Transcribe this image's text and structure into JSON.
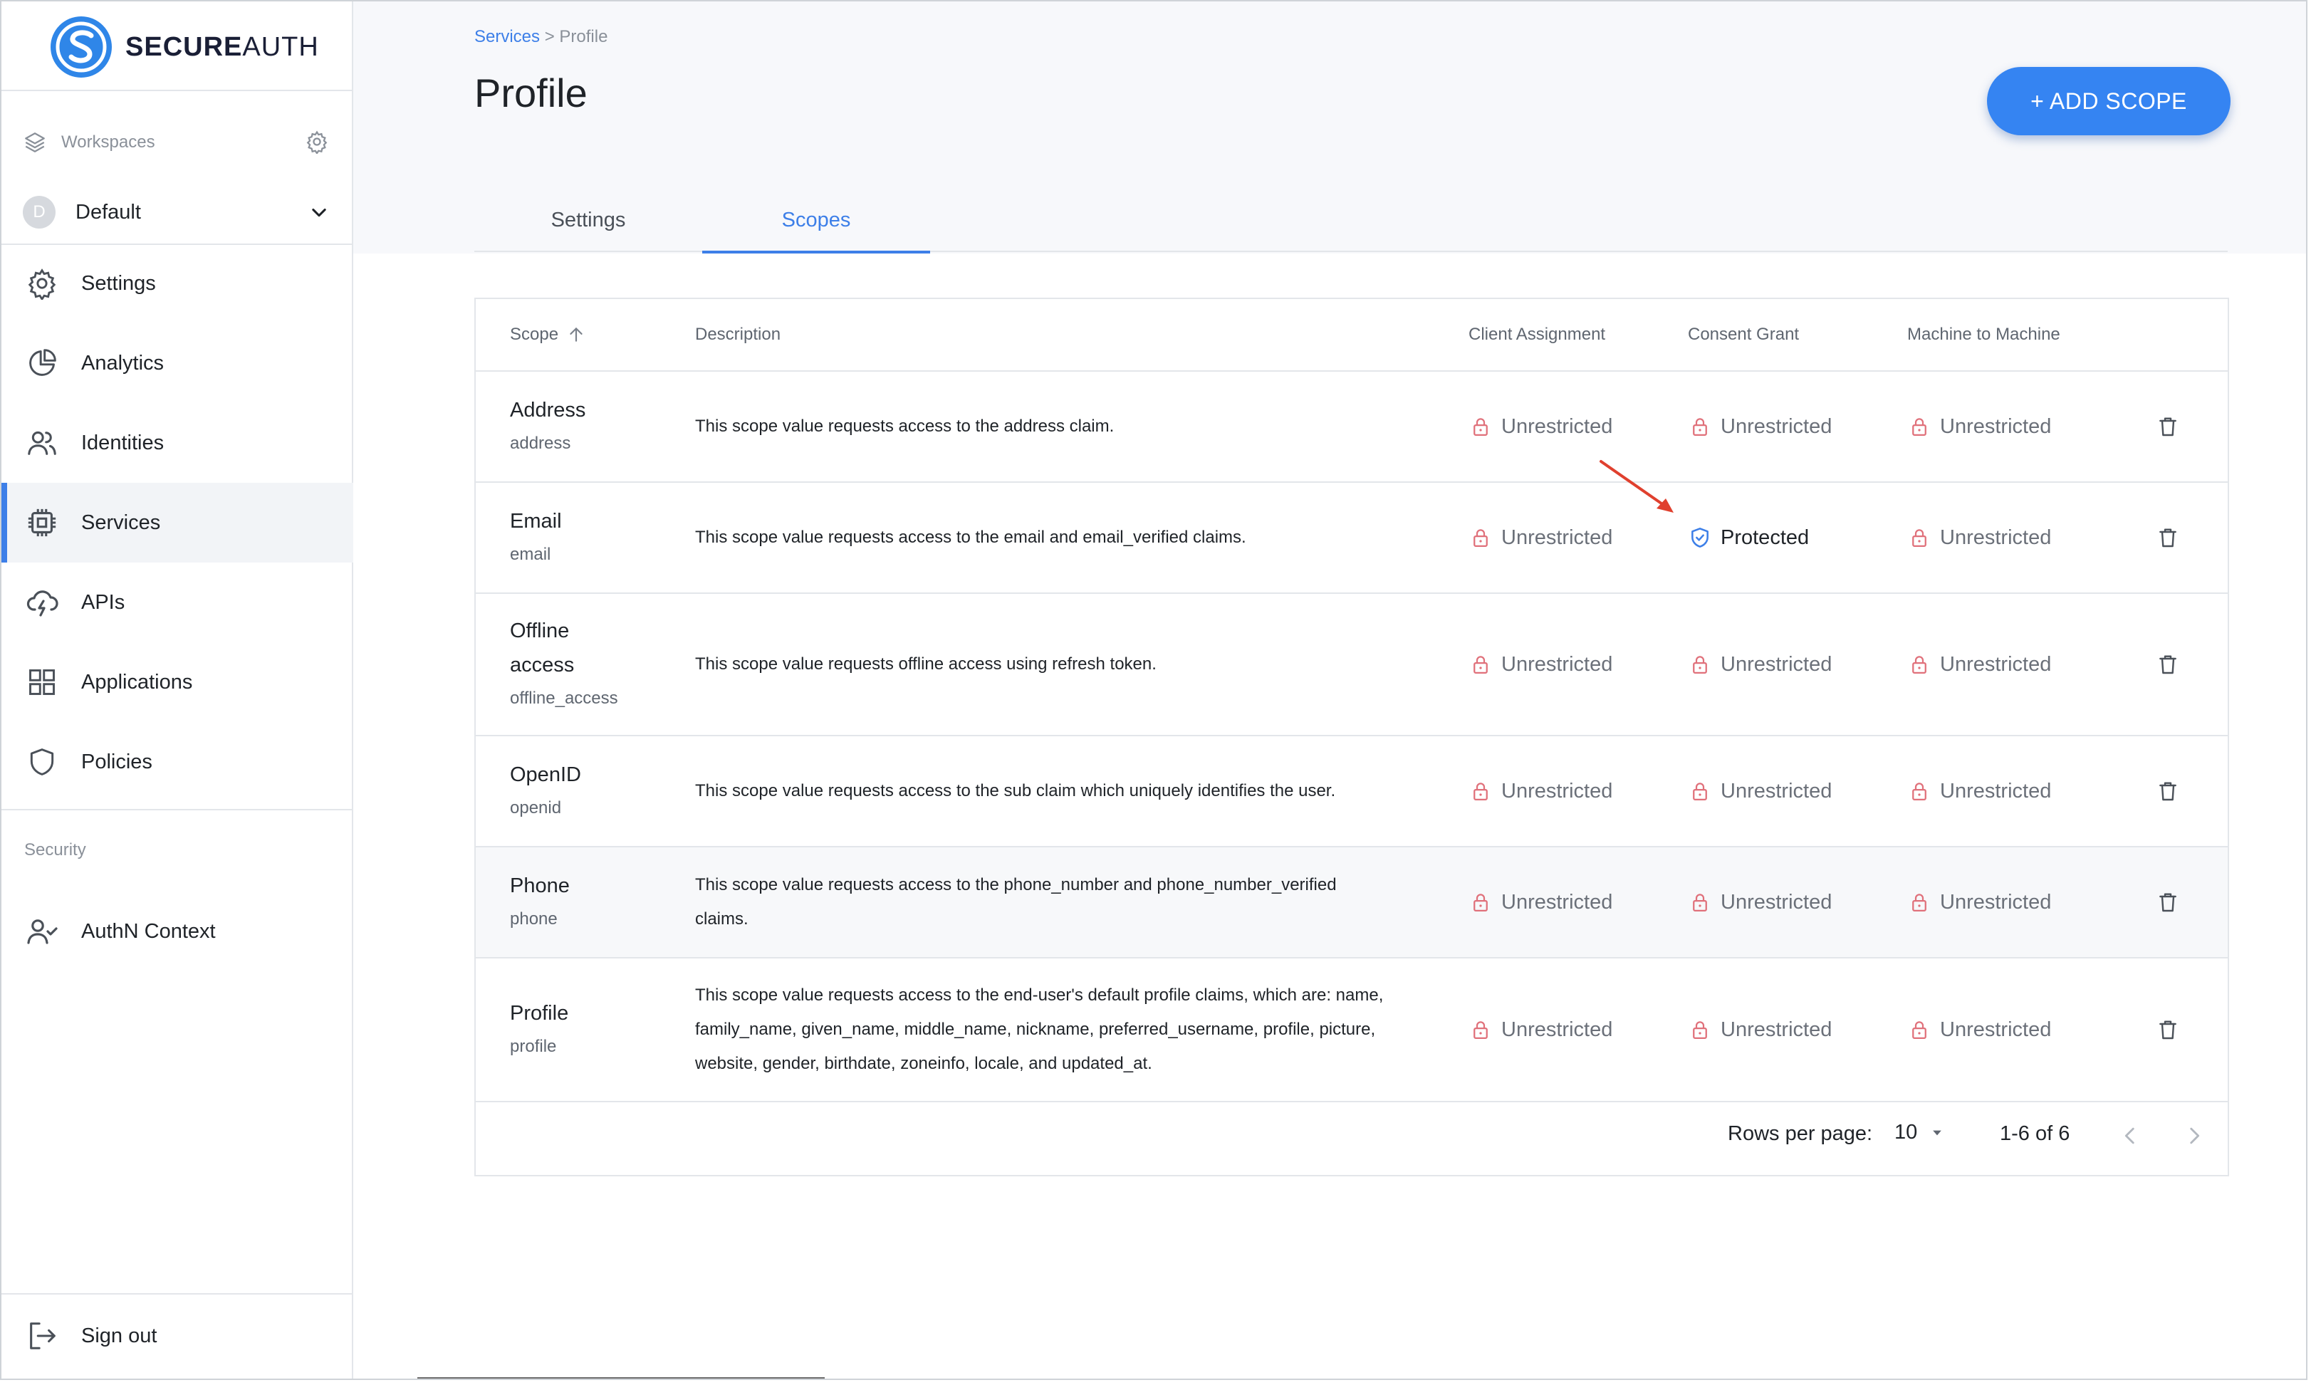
{
  "brand": {
    "bold": "SECURE",
    "regular": "AUTH"
  },
  "sidebar": {
    "workspaces_label": "Workspaces",
    "workspace": {
      "initial": "D",
      "name": "Default"
    },
    "items": [
      {
        "label": "Settings",
        "icon": "gear-icon"
      },
      {
        "label": "Analytics",
        "icon": "pie-chart-icon"
      },
      {
        "label": "Identities",
        "icon": "users-icon"
      },
      {
        "label": "Services",
        "icon": "chip-icon",
        "active": true
      },
      {
        "label": "APIs",
        "icon": "cloud-bolt-icon"
      },
      {
        "label": "Applications",
        "icon": "grid-icon"
      },
      {
        "label": "Policies",
        "icon": "shield-icon"
      }
    ],
    "security_label": "Security",
    "security_items": [
      {
        "label": "AuthN Context",
        "icon": "user-check-icon"
      }
    ],
    "sign_out": "Sign out"
  },
  "header": {
    "breadcrumb": {
      "parent": "Services",
      "separator": ">",
      "current": "Profile"
    },
    "title": "Profile",
    "add_button": "+ ADD SCOPE"
  },
  "tabs": [
    {
      "label": "Settings",
      "active": false
    },
    {
      "label": "Scopes",
      "active": true
    }
  ],
  "table": {
    "columns": {
      "scope": "Scope",
      "description": "Description",
      "client": "Client Assignment",
      "consent": "Consent Grant",
      "m2m": "Machine to Machine"
    },
    "rows": [
      {
        "name": "Address",
        "id": "address",
        "description": "This scope value requests access to the address claim.",
        "client": "Unrestricted",
        "consent": "Unrestricted",
        "m2m": "Unrestricted"
      },
      {
        "name": "Email",
        "id": "email",
        "description": "This scope value requests access to the email and email_verified claims.",
        "client": "Unrestricted",
        "consent": "Protected",
        "m2m": "Unrestricted"
      },
      {
        "name": "Offline access",
        "id": "offline_access",
        "description": "This scope value requests offline access using refresh token.",
        "client": "Unrestricted",
        "consent": "Unrestricted",
        "m2m": "Unrestricted"
      },
      {
        "name": "OpenID",
        "id": "openid",
        "description": "This scope value requests access to the sub claim which uniquely identifies the user.",
        "client": "Unrestricted",
        "consent": "Unrestricted",
        "m2m": "Unrestricted"
      },
      {
        "name": "Phone",
        "id": "phone",
        "description": "This scope value requests access to the phone_number and phone_number_verified claims.",
        "client": "Unrestricted",
        "consent": "Unrestricted",
        "m2m": "Unrestricted"
      },
      {
        "name": "Profile",
        "id": "profile",
        "description": "This scope value requests access to the end-user's default profile claims, which are: name, family_name, given_name, middle_name, nickname, preferred_username, profile, picture, website, gender, birthdate, zoneinfo, locale, and updated_at.",
        "client": "Unrestricted",
        "consent": "Unrestricted",
        "m2m": "Unrestricted"
      }
    ],
    "footer": {
      "rows_per_page_label": "Rows per page:",
      "rows_per_page": "10",
      "range": "1-6 of 6"
    }
  },
  "colors": {
    "accent": "#3d7fe8",
    "lock": "#e0707a",
    "protected": "#3d7fe8"
  }
}
